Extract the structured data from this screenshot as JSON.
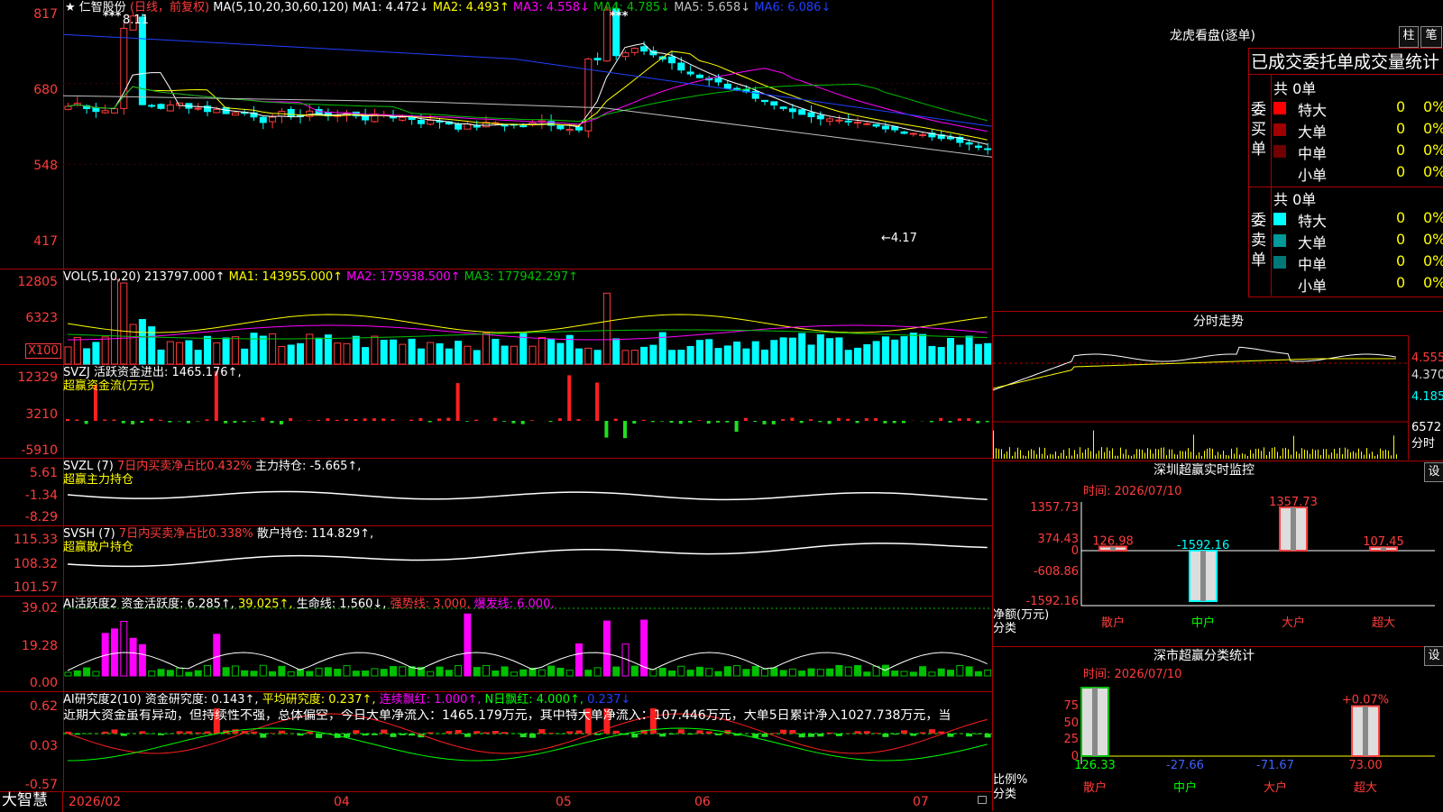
{
  "header": {
    "star": "★",
    "stock_name": "仁智股份",
    "period": "(日线，前复权)",
    "ma_title": "MA(5,10,20,30,60,120)",
    "ma1": "MA1: 4.472↓",
    "ma2": "MA2: 4.493↑",
    "ma3": "MA3: 4.558↓",
    "ma4": "MA4: 4.785↓",
    "ma5": "MA5: 5.658↓",
    "ma6": "MA6: 6.086↓",
    "high_label": "8.11",
    "low_label": "←4.17",
    "stars": "***"
  },
  "price_axis": {
    "ticks": [
      "817",
      "680",
      "548",
      "417"
    ]
  },
  "volume": {
    "title": "VOL(5,10,20)",
    "value": "213797.000↑",
    "ma1": "MA1: 143955.000↑",
    "ma2": "MA2: 175938.500↑",
    "ma3": "MA3: 177942.297↑",
    "ticks": [
      "12805",
      "6323"
    ],
    "unit": "X100"
  },
  "svzj": {
    "line1": "SVZJ  活跃资金进出: 1465.176↑,",
    "line2": "超赢资金流(万元)",
    "ticks": [
      "12329",
      "3210",
      "-5910"
    ]
  },
  "svzl": {
    "line1_a": "SVZL (7) ",
    "line1_b": "7日内买卖净占比0.432%",
    "line1_c": " 主力持仓: -5.665↑,",
    "line2": "超赢主力持仓",
    "ticks": [
      "5.61",
      "-1.34",
      "-8.29"
    ]
  },
  "svsh": {
    "line1_a": "SVSH (7) ",
    "line1_b": "7日内买卖净占比0.338%",
    "line1_c": " 散户持仓: 114.829↑,",
    "line2": "超赢散户持仓",
    "ticks": [
      "115.33",
      "108.32",
      "101.57"
    ]
  },
  "ai_active": {
    "title": "AI活跃度2 资金活跃度: 6.285↑,",
    "v2": "39.025↑,",
    "v3": "生命线: 1.560↓,",
    "v4": "强势线: 3.000,",
    "v5": "爆发线: 6.000,",
    "ticks": [
      "39.02",
      "19.28",
      "0.00"
    ]
  },
  "ai_research": {
    "title": "AI研究度2(10) 资金研究度: 0.143↑,",
    "v2": "平均研究度: 0.237↑,",
    "v3": "连续飘红: 1.000↑,",
    "v4": "N日飘红: 4.000↑,",
    "v5": "0.237↓",
    "comment": "近期大资金虽有异动，但持续性不强，总体偏空，今日大单净流入：1465.179万元，其中特大单净流入：107.446万元，大单5日累计净入1027.738万元，当",
    "ticks": [
      "0.62",
      "0.03",
      "-0.57"
    ]
  },
  "bottom_axis": {
    "brand": "大智慧",
    "dates": [
      "2026/02",
      "04",
      "05",
      "06",
      "07"
    ]
  },
  "right": {
    "lhb_title": "龙虎看盘(逐单)",
    "btn_bar": "柱",
    "btn_tick": "笔",
    "stats_title": "已成交委托单成交量统计",
    "buy_group": "委买单",
    "sell_group": "委卖单",
    "buy_total": "共 0单",
    "sell_total": "共 0单",
    "buy_rows": [
      {
        "label": "特大",
        "count": "0",
        "pct": "0%",
        "color": "#ff0000"
      },
      {
        "label": "大单",
        "count": "0",
        "pct": "0%",
        "color": "#a00000"
      },
      {
        "label": "中单",
        "count": "0",
        "pct": "0%",
        "color": "#700000"
      },
      {
        "label": "小单",
        "count": "0",
        "pct": "0%",
        "color": ""
      }
    ],
    "sell_rows": [
      {
        "label": "特大",
        "count": "0",
        "pct": "0%",
        "color": "#00ffff"
      },
      {
        "label": "大单",
        "count": "0",
        "pct": "0%",
        "color": "#009a9a"
      },
      {
        "label": "中单",
        "count": "0",
        "pct": "0%",
        "color": "#007878"
      },
      {
        "label": "小单",
        "count": "0",
        "pct": "0%",
        "color": ""
      }
    ],
    "intraday_title": "分时走势",
    "intraday_ticks": [
      "4.555",
      "4.370",
      "4.185"
    ],
    "intraday_vol_tick": "6572",
    "intraday_vol_label": "分时",
    "monitor_title": "深圳超赢实时监控",
    "btn_set": "设",
    "monitor_time": "时间: 2026/07/10",
    "monitor_ticks": [
      "1357.73",
      "374.43",
      "0",
      "-608.86",
      "-1592.16"
    ],
    "monitor_ylabel": "净额(万元)",
    "monitor_xlabel": "分类",
    "monitor_bars": [
      {
        "cat": "散户",
        "value": 126.98,
        "label": "126.98",
        "color": "#ff4040"
      },
      {
        "cat": "中户",
        "value": -1592.16,
        "label": "-1592.16",
        "color": "#00ffff"
      },
      {
        "cat": "大户",
        "value": 1357.73,
        "label": "1357.73",
        "color": "#ff4040"
      },
      {
        "cat": "超大",
        "value": 107.45,
        "label": "107.45",
        "color": "#ff4040"
      }
    ],
    "class_title": "深市超赢分类统计",
    "class_time": "时间: 2026/07/10",
    "class_ticks": [
      "75",
      "50",
      "25",
      "0"
    ],
    "class_ylabel": "比例%",
    "class_xlabel": "分类",
    "class_bars": [
      {
        "cat": "散户",
        "value": 100,
        "label": "126.33",
        "color": "#00c000"
      },
      {
        "cat": "中户",
        "value": 0,
        "label": "-27.66",
        "color": "#00ffff"
      },
      {
        "cat": "大户",
        "value": 0,
        "label": "-71.67",
        "color": "#00ffff"
      },
      {
        "cat": "超大",
        "value": 73,
        "label": "73.00",
        "color": "#ff4040",
        "top_label": "+0.07%"
      }
    ]
  },
  "colors": {
    "up": "#ff3c3c",
    "down": "#00ffff",
    "grid": "#aa0000",
    "ma1": "#ffffff",
    "ma2": "#ffff00",
    "ma3": "#ff00ff",
    "ma4": "#00c000",
    "ma5": "#c0c0c0",
    "ma6": "#2040ff"
  }
}
